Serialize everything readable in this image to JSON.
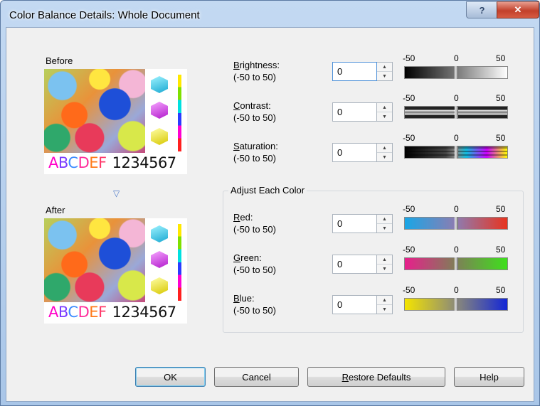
{
  "window": {
    "title": "Color Balance Details: Whole Document",
    "help_glyph": "?",
    "close_glyph": "✕"
  },
  "previews": {
    "before_label": "Before",
    "after_label": "After",
    "sample_letters": [
      "A",
      "B",
      "C",
      "D",
      "E",
      "F"
    ],
    "sample_numbers": "1234567",
    "arrow_glyph": "▽"
  },
  "scale": {
    "min": "-50",
    "mid": "0",
    "max": "50"
  },
  "adjustments": {
    "brightness": {
      "label_access": "B",
      "label_rest": "rightness:",
      "range": "(-50 to 50)",
      "value": "0"
    },
    "contrast": {
      "label_access": "C",
      "label_rest": "ontrast:",
      "range": "(-50 to 50)",
      "value": "0"
    },
    "saturation": {
      "label_access": "S",
      "label_rest": "aturation:",
      "range": "(-50 to 50)",
      "value": "0"
    }
  },
  "adjust_each_color": {
    "title": "Adjust Each Color",
    "red": {
      "label_access": "R",
      "label_rest": "ed:",
      "range": "(-50 to 50)",
      "value": "0"
    },
    "green": {
      "label_access": "G",
      "label_rest": "reen:",
      "range": "(-50 to 50)",
      "value": "0"
    },
    "blue": {
      "label_access": "B",
      "label_rest": "lue:",
      "range": "(-50 to 50)",
      "value": "0"
    }
  },
  "buttons": {
    "ok": "OK",
    "cancel": "Cancel",
    "restore_access": "R",
    "restore_rest": "estore Defaults",
    "help": "Help"
  },
  "icons": {
    "spin_up": "▲",
    "spin_down": "▼"
  }
}
